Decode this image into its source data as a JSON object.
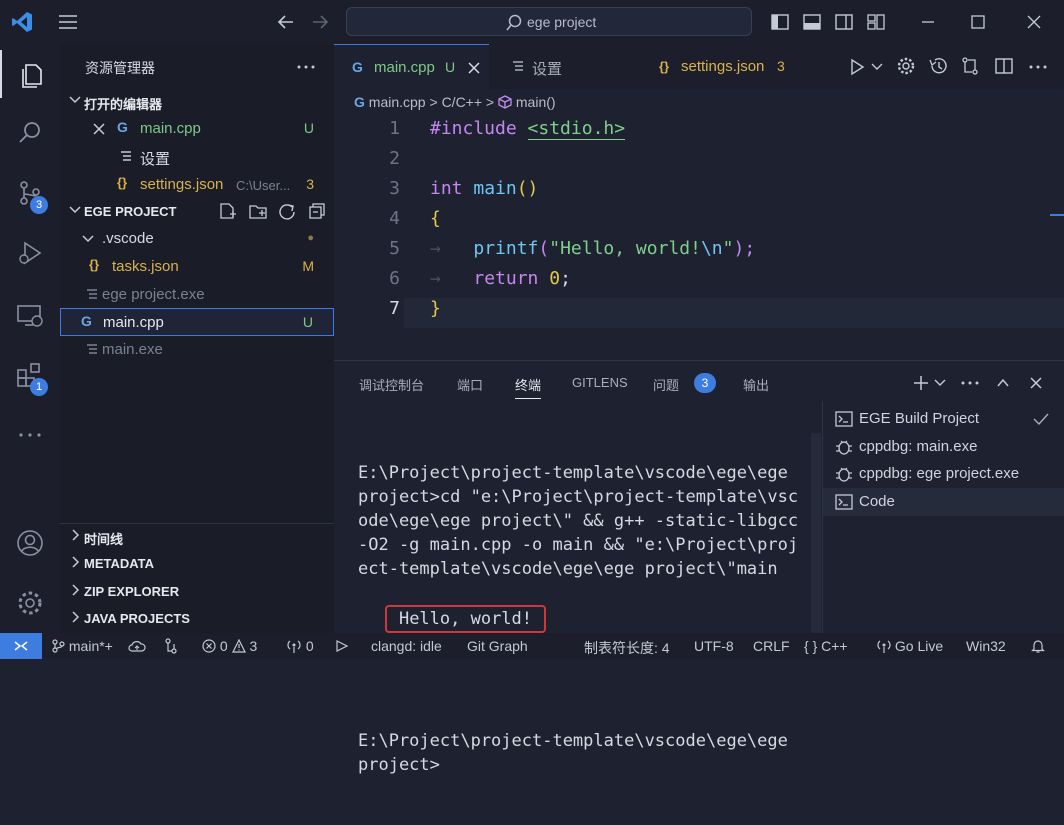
{
  "title": {
    "search": "ege project"
  },
  "sidebar": {
    "title": "资源管理器",
    "open_editors_label": "打开的编辑器",
    "open_editors": [
      {
        "name": "main.cpp",
        "status": "U"
      },
      {
        "name": "设置",
        "status": ""
      },
      {
        "name": "settings.json",
        "path": "C:\\User...",
        "status": "3"
      }
    ],
    "project_label": "EGE PROJECT",
    "tree": [
      {
        "name": ".vscode",
        "status": "●"
      },
      {
        "name": "tasks.json",
        "status": "M"
      },
      {
        "name": "ege project.exe",
        "status": ""
      },
      {
        "name": "main.cpp",
        "status": "U"
      },
      {
        "name": "main.exe",
        "status": ""
      }
    ],
    "bottom_sections": [
      "时间线",
      "METADATA",
      "ZIP EXPLORER",
      "JAVA PROJECTS"
    ]
  },
  "activity": {
    "scm_badge": "3",
    "ext_badge": "1"
  },
  "tabs": [
    {
      "label": "main.cpp",
      "status": "U"
    },
    {
      "label": "设置",
      "status": ""
    },
    {
      "label": "settings.json",
      "status": "3"
    }
  ],
  "breadcrumb": {
    "file": "main.cpp",
    "sep1": ">",
    "lang": "C/C++",
    "sep2": ">",
    "symbol": "main()"
  },
  "code": {
    "line_numbers": [
      "1",
      "2",
      "3",
      "4",
      "5",
      "6",
      "7"
    ],
    "l1_kw": "#include",
    "l1_hdr": "<stdio.h>",
    "l3_type": "int",
    "l3_fn": "main",
    "l3_par": "()",
    "l4": "{",
    "l5_fn": "printf",
    "l5_open": "(",
    "l5_str1": "\"Hello, world!",
    "l5_esc": "\\n",
    "l5_str2": "\"",
    "l5_close": ");",
    "l6_kw": "return",
    "l6_num": "0",
    "l6_end": ";",
    "l7": "}"
  },
  "panel": {
    "tabs": [
      "调试控制台",
      "端口",
      "终端",
      "GITLENS",
      "问题",
      "输出"
    ],
    "problems_count": "3",
    "terminal": {
      "block1": "E:\\Project\\project-template\\vscode\\ege\\ege project>cd \"e:\\Project\\project-template\\vscode\\ege\\ege project\\\" && g++ -static-libgcc -O2 -g main.cpp -o main && \"e:\\Project\\project-template\\vscode\\ege\\ege project\\\"main",
      "output": "Hello, world!",
      "block2": "E:\\Project\\project-template\\vscode\\ege\\ege project>"
    },
    "terminal_list": [
      "EGE Build Project",
      "cppdbg: main.exe",
      "cppdbg: ege project.exe",
      "Code"
    ]
  },
  "status": {
    "branch": "main*+",
    "errors": "0",
    "warnings": "3",
    "ports": "0",
    "clangd": "clangd: idle",
    "git_graph": "Git Graph",
    "tab_size": "制表符长度: 4",
    "encoding": "UTF-8",
    "eol": "CRLF",
    "language": "C++",
    "golive": "Go Live",
    "platform": "Win32"
  },
  "colors": {
    "accent": "#3d7de0",
    "untracked": "#7ec98a",
    "modified": "#d9b24a",
    "keyword": "#c586f0",
    "function": "#6fc6f2",
    "string": "#7fd08a"
  }
}
